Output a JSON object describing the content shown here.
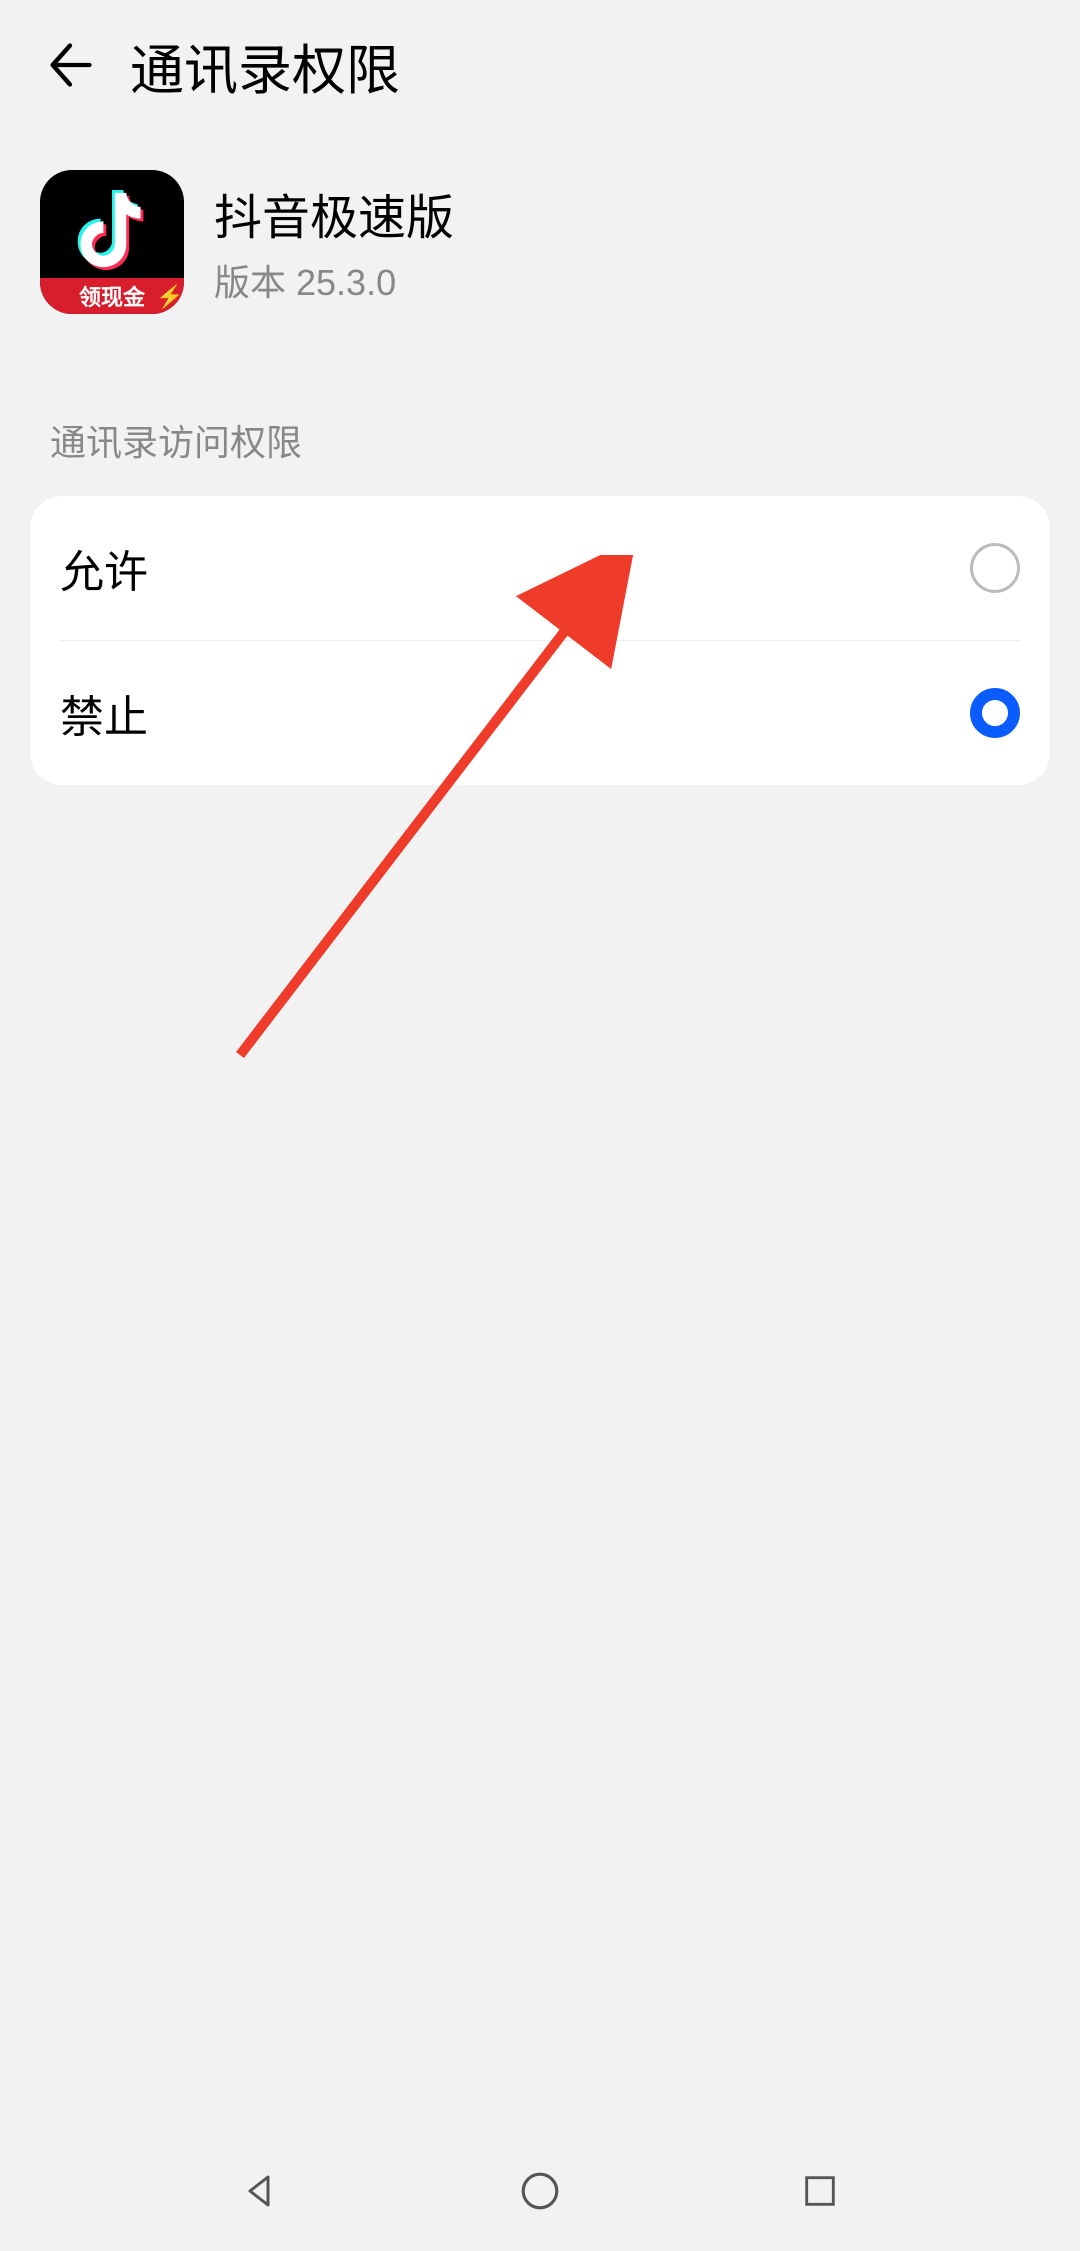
{
  "header": {
    "title": "通讯录权限"
  },
  "app": {
    "name": "抖音极速版",
    "version": "版本 25.3.0",
    "banner_text": "领现金"
  },
  "section": {
    "label": "通讯录访问权限"
  },
  "options": {
    "allow": {
      "label": "允许",
      "selected": false
    },
    "deny": {
      "label": "禁止",
      "selected": true
    }
  }
}
